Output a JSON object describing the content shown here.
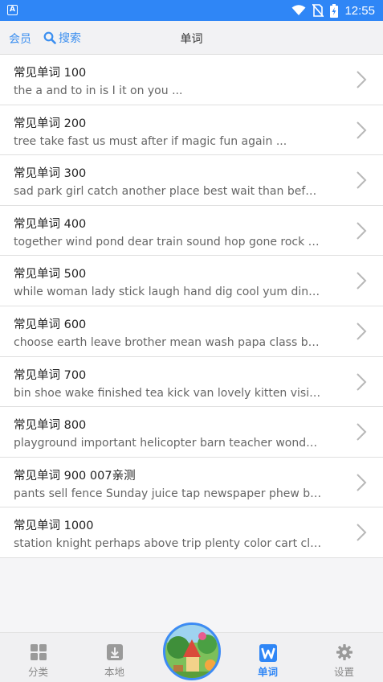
{
  "status_bar": {
    "time": "12:55",
    "app_badge": "A"
  },
  "nav": {
    "member": "会员",
    "search": "搜索",
    "title": "单词"
  },
  "lists": [
    {
      "title": "常见单词 100",
      "subtitle": "the a and to in is I it on you ..."
    },
    {
      "title": "常见单词 200",
      "subtitle": "tree take fast us must after if magic fun again ..."
    },
    {
      "title": "常见单词 300",
      "subtitle": "sad park girl catch another place best wait than before ..."
    },
    {
      "title": "常见单词 400",
      "subtitle": "together wind pond dear train sound hop gone rock which ..."
    },
    {
      "title": "常见单词 500",
      "subtitle": "while woman lady stick laugh hand dig cool yum dinner ..."
    },
    {
      "title": "常见单词 600",
      "subtitle": "choose earth leave brother mean wash papa class brown ..."
    },
    {
      "title": "常见单词 700",
      "subtitle": "bin shoe wake finished tea kick van lovely kitten visit ..."
    },
    {
      "title": "常见单词 800",
      "subtitle": "playground important helicopter barn teacher wonderful ..."
    },
    {
      "title": "常见单词 900 007亲测",
      "subtitle": "pants sell fence Sunday juice tap newspaper phew brave ..."
    },
    {
      "title": "常见单词 1000",
      "subtitle": "station knight perhaps above trip plenty color cart cloud ..."
    }
  ],
  "tabs": {
    "category": "分类",
    "local": "本地",
    "words": "单词",
    "settings": "设置"
  },
  "colors": {
    "accent": "#2f86f6",
    "link": "#3a8ef0"
  }
}
